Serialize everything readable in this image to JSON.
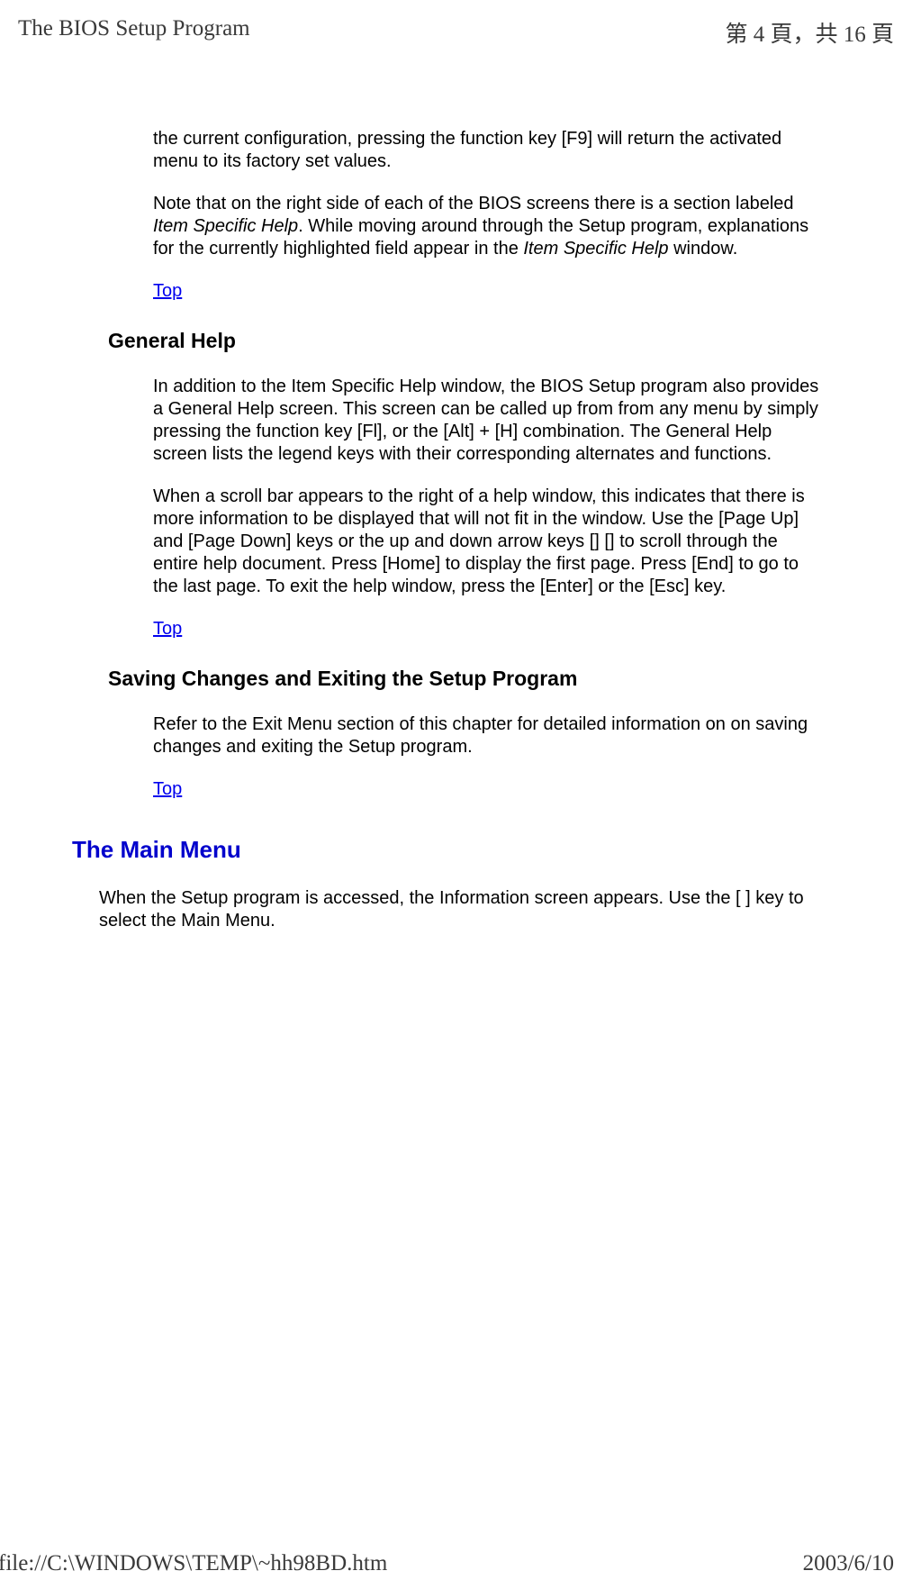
{
  "header": {
    "title": "The BIOS Setup Program",
    "page_indicator": "第 4 頁，共 16 頁"
  },
  "intro": {
    "para1": "the current configuration, pressing the function key [F9] will return the activated menu to its factory set values.",
    "para2_pre": "Note that on the right side of each of the BIOS screens there is a section labeled ",
    "para2_italic1": "Item Specific Help",
    "para2_mid": ". While moving around through the Setup program, explanations for the currently highlighted field appear in the ",
    "para2_italic2": "Item Specific Help",
    "para2_post": " window.",
    "top_link": "Top"
  },
  "general_help": {
    "heading": "General Help",
    "para1": "In addition to the Item Specific Help window, the BIOS Setup program also provides a General Help screen. This screen can be called up from from any menu by simply pressing the function key [Fl], or the [Alt] + [H] combination. The General Help screen lists the legend keys with their corresponding alternates and functions.",
    "para2_pre": "When a scroll bar appears to the right of a help window, this indicates that there is more information to be displayed that will not fit in the window. Use the [Page Up] and [Page Down] keys or the up and down arrow keys [",
    "para2_mid": "] [",
    "para2_post": "] to scroll through the entire help document. Press [Home] to display the first page. Press [End] to go to the last page. To exit the help window, press the [Enter] or the [Esc] key.",
    "top_link": "Top"
  },
  "saving": {
    "heading": "Saving Changes and Exiting the Setup Program",
    "para1": "Refer to the Exit Menu section of this chapter for detailed information on on saving changes and exiting the Setup program.",
    "top_link": "Top"
  },
  "main_menu": {
    "heading": "The Main Menu",
    "para1_pre": "When the Setup program is accessed, the Information screen appears. Use the [ ",
    "para1_post": "] key to select the Main Menu."
  },
  "footer": {
    "path": "file://C:\\WINDOWS\\TEMP\\~hh98BD.htm",
    "date": "2003/6/10"
  }
}
